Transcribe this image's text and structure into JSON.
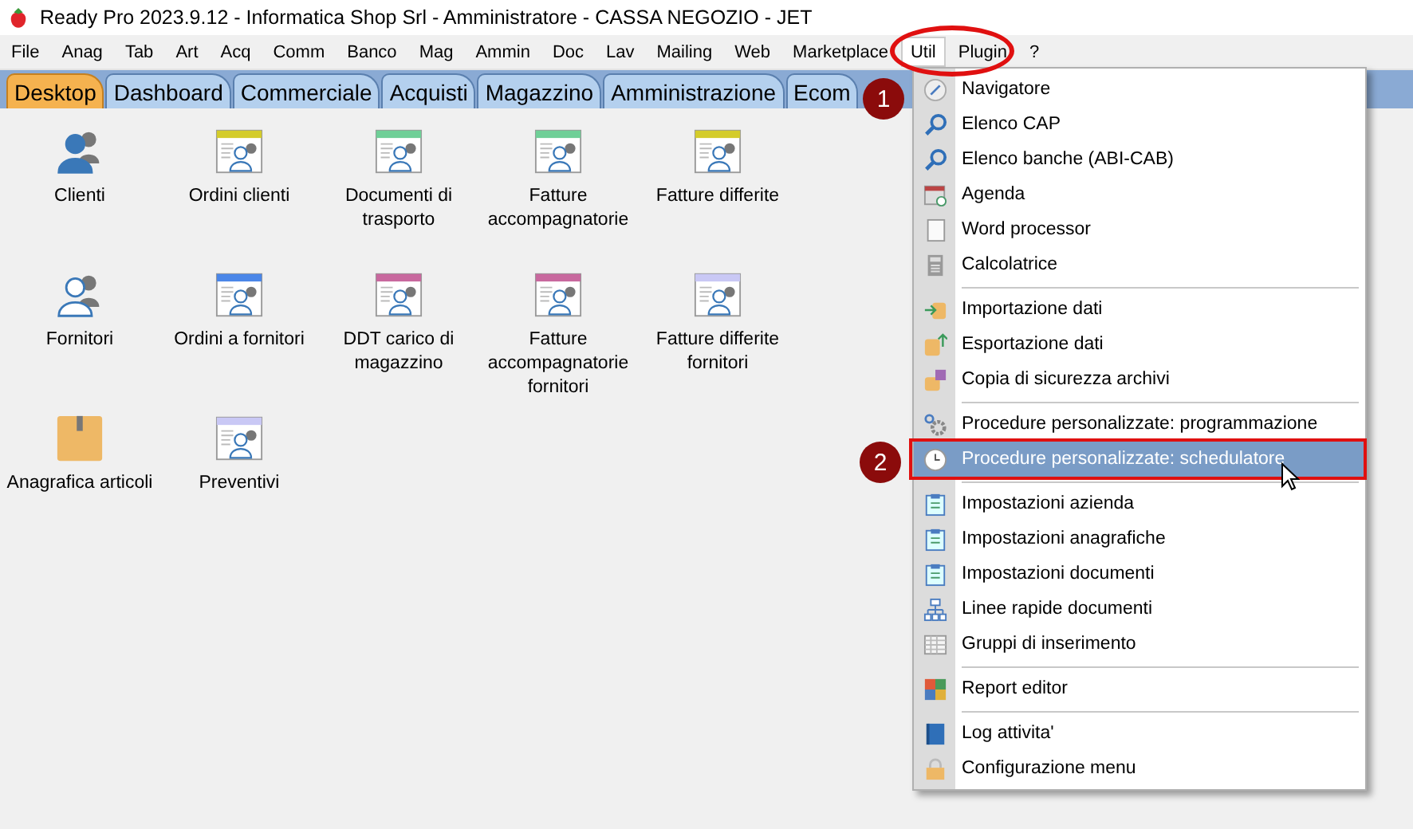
{
  "window": {
    "title": "Ready Pro 2023.9.12 - Informatica Shop Srl - Amministratore - CASSA NEGOZIO - JET"
  },
  "menu_bar": [
    {
      "label": "File",
      "selected": false
    },
    {
      "label": "Anag",
      "selected": false
    },
    {
      "label": "Tab",
      "selected": false
    },
    {
      "label": "Art",
      "selected": false
    },
    {
      "label": "Acq",
      "selected": false
    },
    {
      "label": "Comm",
      "selected": false
    },
    {
      "label": "Banco",
      "selected": false
    },
    {
      "label": "Mag",
      "selected": false
    },
    {
      "label": "Ammin",
      "selected": false
    },
    {
      "label": "Doc",
      "selected": false
    },
    {
      "label": "Lav",
      "selected": false
    },
    {
      "label": "Mailing",
      "selected": false
    },
    {
      "label": "Web",
      "selected": false
    },
    {
      "label": "Marketplace",
      "selected": false
    },
    {
      "label": "Util",
      "selected": true
    },
    {
      "label": "Plugin",
      "selected": false
    },
    {
      "label": "?",
      "selected": false
    }
  ],
  "tabs": [
    {
      "label": "Desktop",
      "selected": true
    },
    {
      "label": "Dashboard",
      "selected": false
    },
    {
      "label": "Commerciale",
      "selected": false
    },
    {
      "label": "Acquisti",
      "selected": false
    },
    {
      "label": "Magazzino",
      "selected": false
    },
    {
      "label": "Amministrazione",
      "selected": false
    },
    {
      "label": "Ecom",
      "selected": false
    }
  ],
  "desktop": [
    {
      "label": "Clienti",
      "kind": "contact"
    },
    {
      "label": "Ordini clienti",
      "kind": "document",
      "color": "#d4cc2a"
    },
    {
      "label": "Documenti di trasporto",
      "kind": "document",
      "color": "#6fcf97"
    },
    {
      "label": "Fatture accompagnatorie",
      "kind": "document",
      "color": "#6fcf97"
    },
    {
      "label": "Fatture differite",
      "kind": "document",
      "color": "#d4cc2a"
    },
    {
      "label": "Fornitori",
      "kind": "supplier"
    },
    {
      "label": "Ordini a fornitori",
      "kind": "document",
      "color": "#4a86e8"
    },
    {
      "label": "DDT carico di magazzino",
      "kind": "document",
      "color": "#c8689e"
    },
    {
      "label": "Fatture accompagnatorie fornitori",
      "kind": "document",
      "color": "#c8689e"
    },
    {
      "label": "Fatture differite fornitori",
      "kind": "document",
      "color": "#c9c8f5"
    },
    {
      "label": "Anagrafica articoli",
      "kind": "product"
    },
    {
      "label": "Preventivi",
      "kind": "document",
      "color": "#c9c8f5"
    }
  ],
  "dropdown_menu": [
    {
      "kind": "item",
      "label": "Navigatore",
      "selected": false
    },
    {
      "kind": "item",
      "label": "Elenco CAP",
      "selected": false
    },
    {
      "kind": "item",
      "label": "Elenco banche (ABI-CAB)",
      "selected": false
    },
    {
      "kind": "item",
      "label": "Agenda",
      "selected": false
    },
    {
      "kind": "item",
      "label": "Word processor",
      "selected": false
    },
    {
      "kind": "item",
      "label": "Calcolatrice",
      "selected": false
    },
    {
      "kind": "separator"
    },
    {
      "kind": "item",
      "label": "Importazione dati",
      "selected": false
    },
    {
      "kind": "item",
      "label": "Esportazione dati",
      "selected": false
    },
    {
      "kind": "item",
      "label": "Copia di sicurezza archivi",
      "selected": false
    },
    {
      "kind": "separator"
    },
    {
      "kind": "item",
      "label": "Procedure personalizzate: programmazione",
      "selected": false
    },
    {
      "kind": "item",
      "label": "Procedure personalizzate: schedulatore",
      "selected": true
    },
    {
      "kind": "separator"
    },
    {
      "kind": "item",
      "label": "Impostazioni azienda",
      "selected": false
    },
    {
      "kind": "item",
      "label": "Impostazioni anagrafiche",
      "selected": false
    },
    {
      "kind": "item",
      "label": "Impostazioni documenti",
      "selected": false
    },
    {
      "kind": "item",
      "label": "Linee rapide documenti",
      "selected": false
    },
    {
      "kind": "item",
      "label": "Gruppi di inserimento",
      "selected": false
    },
    {
      "kind": "separator"
    },
    {
      "kind": "item",
      "label": "Report editor",
      "selected": false
    },
    {
      "kind": "separator"
    },
    {
      "kind": "item",
      "label": "Log attivita'",
      "selected": false
    },
    {
      "kind": "item",
      "label": "Configurazione menu",
      "selected": false
    }
  ],
  "step_badges": [
    "1",
    "2"
  ]
}
